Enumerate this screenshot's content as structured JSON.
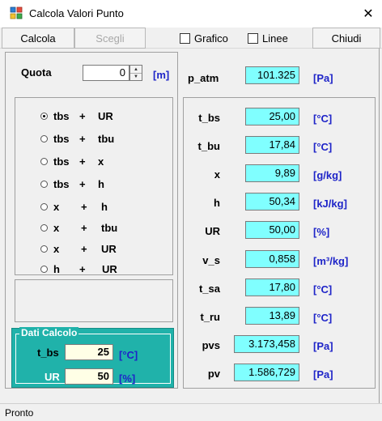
{
  "window": {
    "title": "Calcola Valori Punto",
    "close_symbol": "✕"
  },
  "toolbar": {
    "calcola": "Calcola",
    "scegli": "Scegli",
    "grafico": "Grafico",
    "linee": "Linee",
    "chiudi": "Chiudi"
  },
  "quota": {
    "label": "Quota",
    "value": "0",
    "unit": "[m]"
  },
  "patm": {
    "label": "p_atm",
    "value": "101.325",
    "unit": "[Pa]"
  },
  "radio_options": [
    {
      "a": "tbs",
      "op": "+",
      "b": "UR",
      "selected": true
    },
    {
      "a": "tbs",
      "op": "+",
      "b": "tbu",
      "selected": false
    },
    {
      "a": "tbs",
      "op": "+",
      "b": "x",
      "selected": false
    },
    {
      "a": "tbs",
      "op": "+",
      "b": "h",
      "selected": false
    },
    {
      "a": "x",
      "op": "+",
      "b": "h",
      "selected": false
    },
    {
      "a": "x",
      "op": "+",
      "b": "tbu",
      "selected": false
    },
    {
      "a": "x",
      "op": "+",
      "b": "UR",
      "selected": false
    },
    {
      "a": "h",
      "op": "+",
      "b": "UR",
      "selected": false
    }
  ],
  "dati_calcolo": {
    "title": "Dati Calcolo",
    "tbs": {
      "label": "t_bs",
      "value": "25",
      "unit": "[°C]"
    },
    "ur": {
      "label": "UR",
      "value": "50",
      "unit": "[%]"
    }
  },
  "results": [
    {
      "label": "t_bs",
      "value": "25,00",
      "unit": "[°C]"
    },
    {
      "label": "t_bu",
      "value": "17,84",
      "unit": "[°C]"
    },
    {
      "label": "x",
      "value": "9,89",
      "unit": "[g/kg]"
    },
    {
      "label": "h",
      "value": "50,34",
      "unit": "[kJ/kg]"
    },
    {
      "label": "UR",
      "value": "50,00",
      "unit": "[%]"
    },
    {
      "label": "v_s",
      "value": "0,858",
      "unit": "[m³/kg]"
    },
    {
      "label": "t_sa",
      "value": "17,80",
      "unit": "[°C]"
    },
    {
      "label": "t_ru",
      "value": "13,89",
      "unit": "[°C]"
    },
    {
      "label": "pvs",
      "value": "3.173,458",
      "unit": "[Pa]"
    },
    {
      "label": "pv",
      "value": "1.586,729",
      "unit": "[Pa]"
    }
  ],
  "status": {
    "text": "Pronto"
  },
  "colors": {
    "accent_teal": "#20b2aa",
    "value_cyan": "#80ffff",
    "unit_blue": "#1e24c8"
  }
}
